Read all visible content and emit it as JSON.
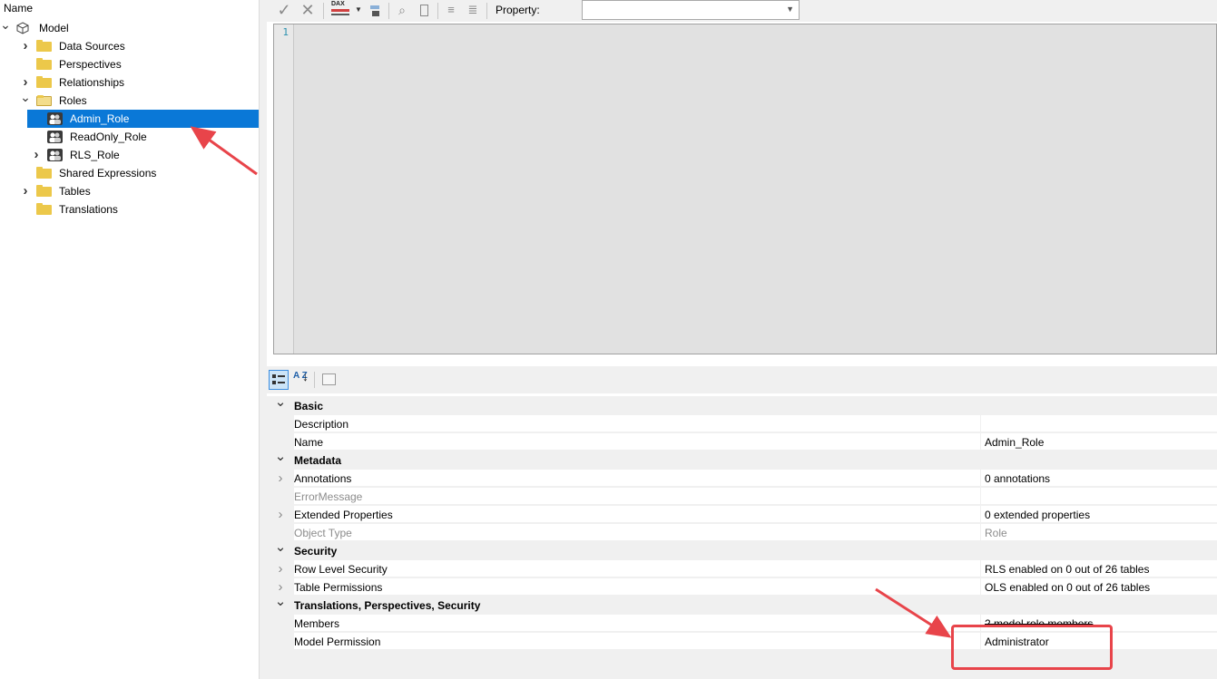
{
  "tree": {
    "header": "Name",
    "nodes": [
      {
        "label": "Model",
        "expander": "v",
        "icon": "model-cube-icon"
      },
      {
        "label": "Data Sources",
        "expander": ">",
        "icon": "folder-icon"
      },
      {
        "label": "Perspectives",
        "expander": "",
        "icon": "folder-icon"
      },
      {
        "label": "Relationships",
        "expander": ">",
        "icon": "folder-icon"
      },
      {
        "label": "Roles",
        "expander": "v",
        "icon": "folder-open-icon"
      },
      {
        "label": "Admin_Role",
        "expander": "",
        "icon": "role-icon",
        "selected": true
      },
      {
        "label": "ReadOnly_Role",
        "expander": "",
        "icon": "role-icon"
      },
      {
        "label": "RLS_Role",
        "expander": ">",
        "icon": "role-icon"
      },
      {
        "label": "Shared Expressions",
        "expander": "",
        "icon": "folder-icon"
      },
      {
        "label": "Tables",
        "expander": ">",
        "icon": "folder-icon"
      },
      {
        "label": "Translations",
        "expander": "",
        "icon": "folder-icon"
      }
    ]
  },
  "toolbar": {
    "accept_icon": "✓",
    "cancel_icon": "✕",
    "dax_label": "DAX",
    "property_label": "Property:",
    "property_value": ""
  },
  "editor": {
    "line_number": "1"
  },
  "property_grid": {
    "toolbar": [
      "categorized-icon",
      "alphabetical-icon",
      "property-pages-icon"
    ],
    "alpha_label": "A Z",
    "rows": [
      {
        "type": "cat",
        "exp": "v",
        "name": "Basic",
        "value": ""
      },
      {
        "type": "prop",
        "exp": "",
        "name": "Description",
        "value": ""
      },
      {
        "type": "prop",
        "exp": "",
        "name": "Name",
        "value": "Admin_Role"
      },
      {
        "type": "cat",
        "exp": "v",
        "name": "Metadata",
        "value": ""
      },
      {
        "type": "prop",
        "exp": ">",
        "name": "Annotations",
        "value": "0 annotations"
      },
      {
        "type": "dim",
        "exp": "",
        "name": "ErrorMessage",
        "value": ""
      },
      {
        "type": "prop",
        "exp": ">",
        "name": "Extended Properties",
        "value": "0 extended properties"
      },
      {
        "type": "dim",
        "exp": "",
        "name": "Object Type",
        "value": "Role"
      },
      {
        "type": "cat",
        "exp": "v",
        "name": "Security",
        "value": ""
      },
      {
        "type": "prop",
        "exp": ">",
        "name": "Row Level Security",
        "value": "RLS enabled on 0 out of 26 tables"
      },
      {
        "type": "prop",
        "exp": ">",
        "name": "Table Permissions",
        "value": "OLS enabled on 0 out of 26 tables"
      },
      {
        "type": "cat",
        "exp": "v",
        "name": "Translations, Perspectives, Security",
        "value": ""
      },
      {
        "type": "prop",
        "exp": "",
        "name": "Members",
        "value": "2 model role members"
      },
      {
        "type": "prop",
        "exp": "",
        "name": "Model Permission",
        "value": "Administrator"
      }
    ]
  },
  "colors": {
    "selection": "#0a78d7",
    "annotation": "#e8444a",
    "folder": "#ecc84a"
  }
}
